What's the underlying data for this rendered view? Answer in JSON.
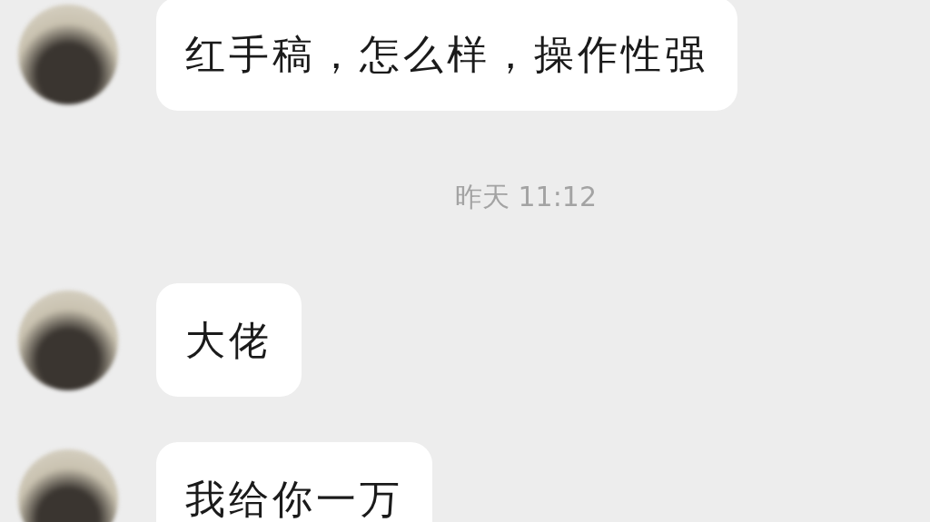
{
  "messages": [
    {
      "kind": "message",
      "text": "红手稿，怎么样，操作性强"
    },
    {
      "kind": "timestamp",
      "text": "昨天 11:12"
    },
    {
      "kind": "message",
      "text": "大佬"
    },
    {
      "kind": "message",
      "text": "我给你一万"
    }
  ]
}
